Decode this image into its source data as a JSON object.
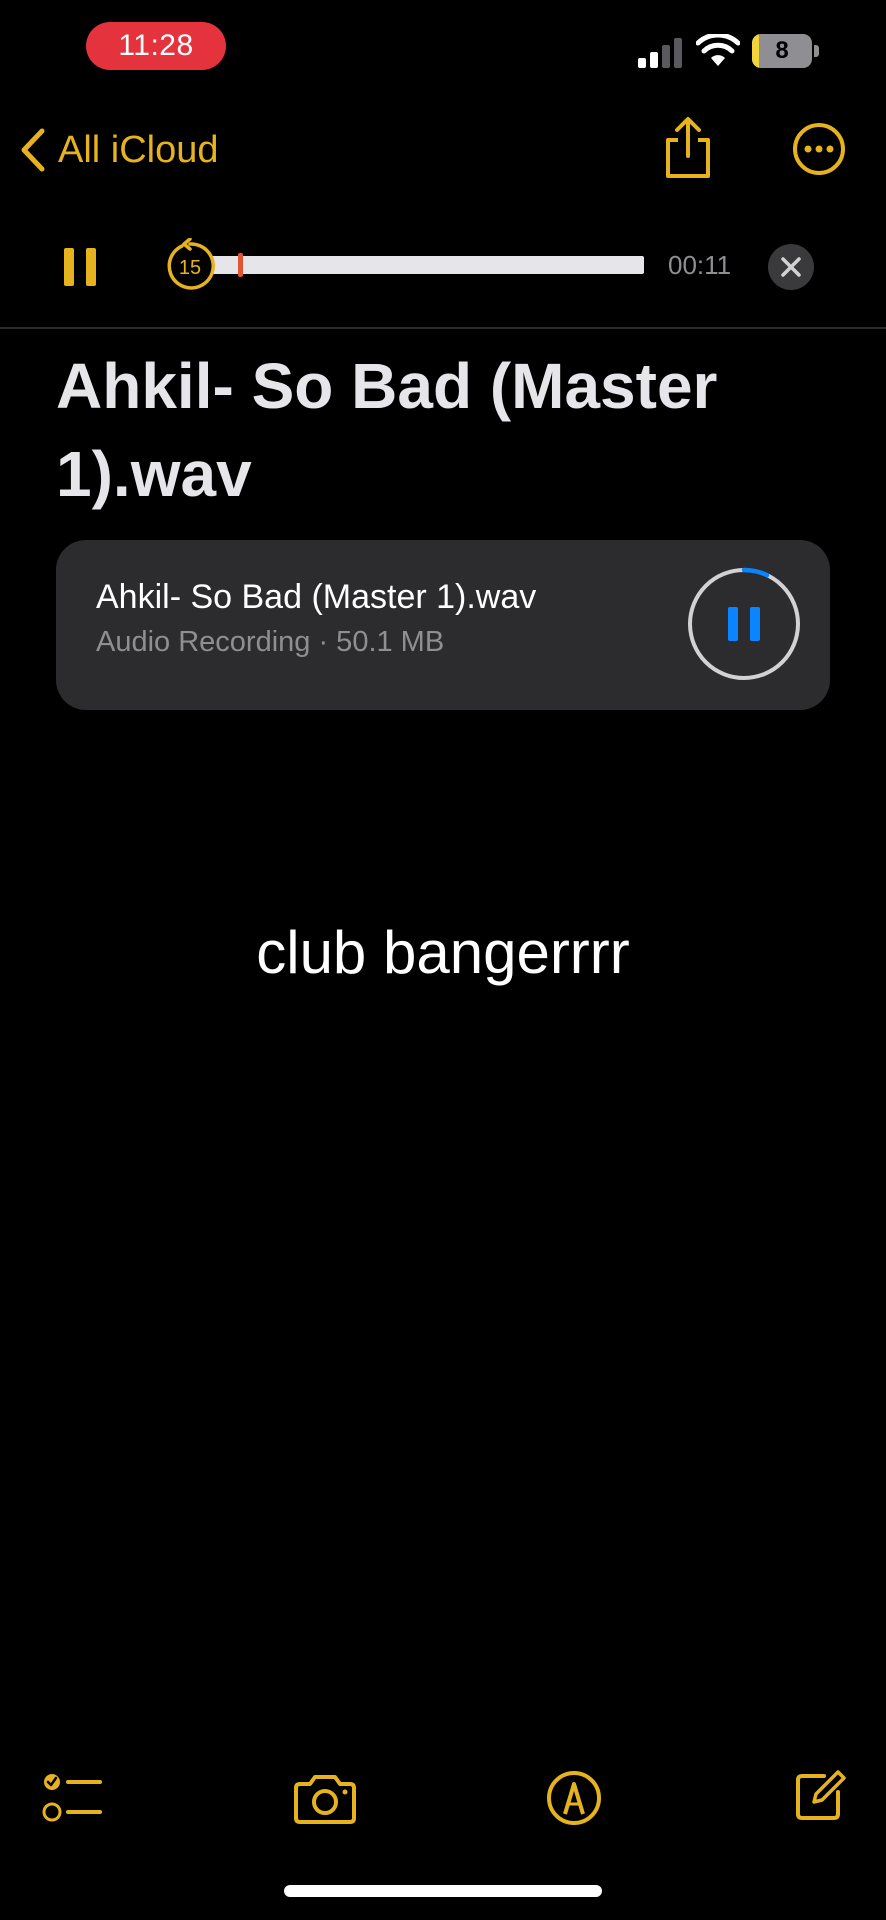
{
  "status_bar": {
    "time": "11:28",
    "battery_level": "8",
    "battery_fraction": 0.08
  },
  "nav": {
    "back_label": "All iCloud",
    "back_icon": "chevron-left-icon",
    "share_icon": "share-icon",
    "more_icon": "ellipsis-circle-icon"
  },
  "player": {
    "skip_back_seconds": "15",
    "elapsed": "00:11",
    "progress_fraction": 0.07,
    "pause_icon": "pause-icon",
    "close_icon": "close-icon"
  },
  "note": {
    "title": "Ahkil- So Bad (Master 1).wav",
    "attachment": {
      "name": "Ahkil- So Bad (Master 1).wav",
      "meta": "Audio Recording · 50.1 MB",
      "playback_fraction": 0.07
    },
    "body": "club bangerrrr"
  },
  "toolbar": {
    "checklist_icon": "checklist-icon",
    "camera_icon": "camera-icon",
    "markup_icon": "markup-pen-icon",
    "compose_icon": "compose-icon"
  },
  "colors": {
    "accent": "#e6b31e",
    "background": "#000000",
    "card": "#2c2c2e",
    "secondary_text": "#8e8e93",
    "recording_pill": "#e5333e",
    "playhead": "#e0542f",
    "play_blue": "#0a84ff"
  }
}
